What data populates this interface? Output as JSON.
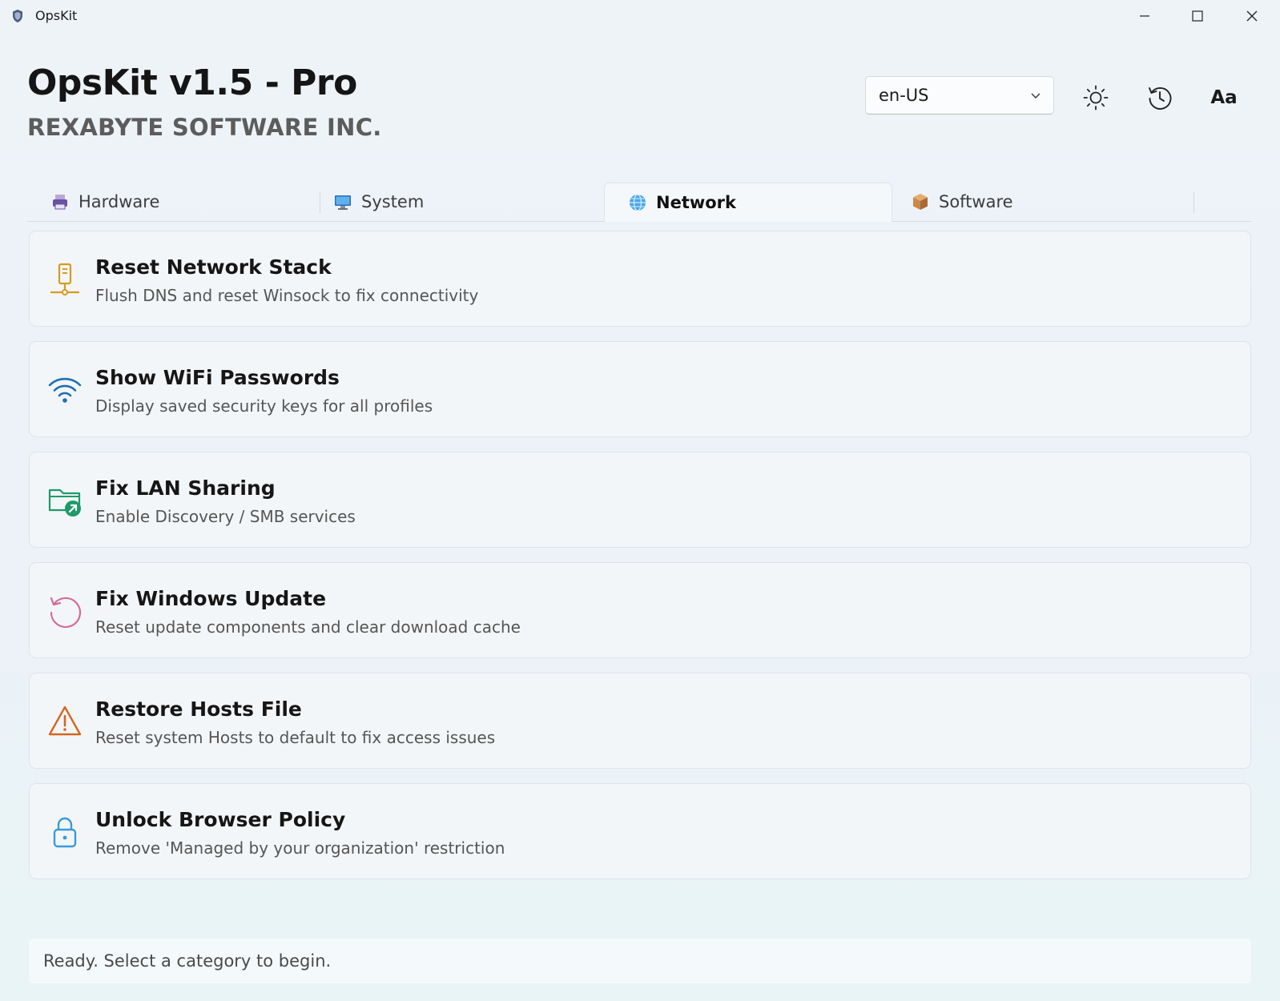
{
  "window": {
    "title": "OpsKit",
    "controls": [
      "minimize",
      "maximize",
      "close"
    ]
  },
  "header": {
    "title": "OpsKit v1.5 - Pro",
    "subtitle": "REXABYTE SOFTWARE INC."
  },
  "toolbar": {
    "language": {
      "selected": "en-US"
    },
    "buttons": [
      {
        "name": "theme",
        "icon": "sun-icon"
      },
      {
        "name": "history",
        "icon": "history-icon"
      },
      {
        "name": "font-size",
        "label": "Aa"
      }
    ]
  },
  "tabs": [
    {
      "label": "Hardware",
      "icon": "printer-icon",
      "active": false
    },
    {
      "label": "System",
      "icon": "monitor-icon",
      "active": false
    },
    {
      "label": "Network",
      "icon": "globe-icon",
      "active": true
    },
    {
      "label": "Software",
      "icon": "package-icon",
      "active": false
    }
  ],
  "cards": [
    {
      "title": "Reset Network Stack",
      "description": "Flush DNS and reset Winsock to fix connectivity",
      "icon": "network-server-icon",
      "color": "#d99a1f"
    },
    {
      "title": "Show WiFi Passwords",
      "description": "Display saved security keys for all profiles",
      "icon": "wifi-icon",
      "color": "#1f6fb5"
    },
    {
      "title": "Fix LAN Sharing",
      "description": "Enable Discovery / SMB services",
      "icon": "folder-share-icon",
      "color": "#1e9a6a"
    },
    {
      "title": "Fix Windows Update",
      "description": "Reset update components and clear download cache",
      "icon": "refresh-icon",
      "color": "#d56a9a"
    },
    {
      "title": "Restore Hosts File",
      "description": "Reset system Hosts to default to fix access issues",
      "icon": "warning-icon",
      "color": "#d4661e"
    },
    {
      "title": "Unlock Browser Policy",
      "description": "Remove 'Managed by your organization' restriction",
      "icon": "lock-icon",
      "color": "#3a9ad9"
    }
  ],
  "status": {
    "text": "Ready. Select a category to begin."
  }
}
